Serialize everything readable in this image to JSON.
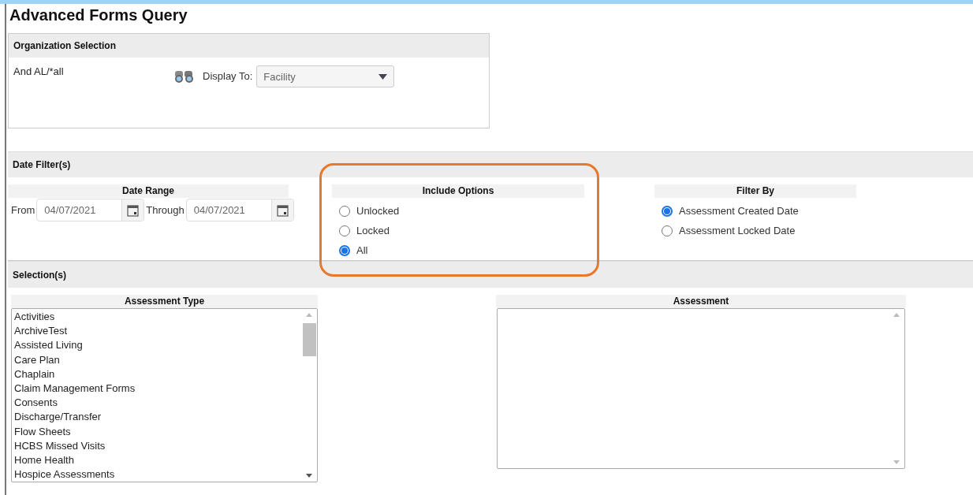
{
  "title": "Advanced Forms Query",
  "organization": {
    "heading": "Organization Selection",
    "selection": "And AL/*all",
    "display_label": "Display To:",
    "display_value": "Facility"
  },
  "date_filters": {
    "heading": "Date Filter(s)",
    "date_range": {
      "heading": "Date Range",
      "from_label": "From",
      "from_value": "04/07/2021",
      "through_label": "Through",
      "through_value": "04/07/2021"
    },
    "include_options": {
      "heading": "Include Options",
      "highlighted": true,
      "options": [
        {
          "label": "Unlocked",
          "selected": false
        },
        {
          "label": "Locked",
          "selected": false
        },
        {
          "label": "All",
          "selected": true
        }
      ]
    },
    "filter_by": {
      "heading": "Filter By",
      "options": [
        {
          "label": "Assessment Created Date",
          "selected": true
        },
        {
          "label": "Assessment Locked Date",
          "selected": false
        }
      ]
    }
  },
  "selections": {
    "heading": "Selection(s)",
    "assessment_type": {
      "heading": "Assessment Type",
      "items": [
        "Activities",
        "ArchiveTest",
        "Assisted Living",
        "Care Plan",
        "Chaplain",
        "Claim Management Forms",
        "Consents",
        "Discharge/Transfer",
        "Flow Sheets",
        "HCBS Missed Visits",
        "Home Health",
        "Hospice Assessments"
      ]
    },
    "assessment": {
      "heading": "Assessment"
    }
  }
}
